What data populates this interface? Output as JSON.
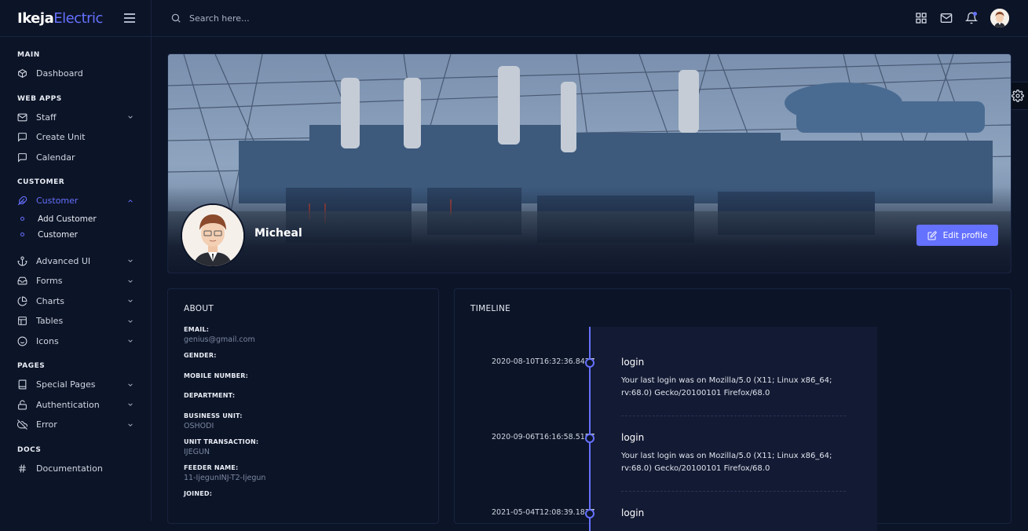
{
  "brand": {
    "part1": "Ikeja",
    "part2": "Electric"
  },
  "search": {
    "placeholder": "Search here..."
  },
  "sidebar": {
    "sections": [
      {
        "title": "MAIN",
        "items": [
          {
            "label": "Dashboard",
            "icon": "box-icon"
          }
        ]
      },
      {
        "title": "WEB APPS",
        "items": [
          {
            "label": "Staff",
            "icon": "mail-icon"
          },
          {
            "label": "Create Unit",
            "icon": "message-square-icon"
          },
          {
            "label": "Calendar",
            "icon": "message-square-icon"
          }
        ]
      },
      {
        "title": "CUSTOMER",
        "items": [
          {
            "label": "Customer",
            "icon": "feather-icon"
          },
          {
            "label": "Add Customer"
          },
          {
            "label": "Customer"
          },
          {
            "label": "Advanced UI",
            "icon": "anchor-icon"
          },
          {
            "label": "Forms",
            "icon": "inbox-icon"
          },
          {
            "label": "Charts",
            "icon": "pie-chart-icon"
          },
          {
            "label": "Tables",
            "icon": "layout-icon"
          },
          {
            "label": "Icons",
            "icon": "smile-icon"
          }
        ]
      },
      {
        "title": "PAGES",
        "items": [
          {
            "label": "Special Pages",
            "icon": "book-icon"
          },
          {
            "label": "Authentication",
            "icon": "unlock-icon"
          },
          {
            "label": "Error",
            "icon": "cloud-off-icon"
          }
        ]
      },
      {
        "title": "DOCS",
        "items": [
          {
            "label": "Documentation",
            "icon": "hash-icon"
          }
        ]
      }
    ]
  },
  "profile": {
    "name": "Micheal",
    "edit_label": "Edit profile"
  },
  "about": {
    "title": "ABOUT",
    "fields": [
      {
        "label": "EMAIL:",
        "value": "genius@gmail.com"
      },
      {
        "label": "GENDER:",
        "value": ""
      },
      {
        "label": "MOBILE NUMBER:",
        "value": ""
      },
      {
        "label": "DEPARTMENT:",
        "value": ""
      },
      {
        "label": "BUSINESS UNIT:",
        "value": "OSHODI"
      },
      {
        "label": "UNIT TRANSACTION:",
        "value": "IJEGUN"
      },
      {
        "label": "FEEDER NAME:",
        "value": "11-IjegunINJ-T2-Ijegun"
      },
      {
        "label": "JOINED:",
        "value": ""
      }
    ]
  },
  "timeline": {
    "title": "TIMELINE",
    "entries": [
      {
        "date": "2020-08-10T16:32:36.842Z",
        "title": "login",
        "desc": "Your last login was on Mozilla/5.0 (X11; Linux x86_64; rv:68.0) Gecko/20100101 Firefox/68.0"
      },
      {
        "date": "2020-09-06T16:16:58.515Z",
        "title": "login",
        "desc": "Your last login was on Mozilla/5.0 (X11; Linux x86_64; rv:68.0) Gecko/20100101 Firefox/68.0"
      },
      {
        "date": "2021-05-04T12:08:39.182Z",
        "title": "login",
        "desc": ""
      }
    ]
  },
  "colors": {
    "accent": "#6571ff",
    "background": "#0c1427",
    "border": "#172340"
  }
}
